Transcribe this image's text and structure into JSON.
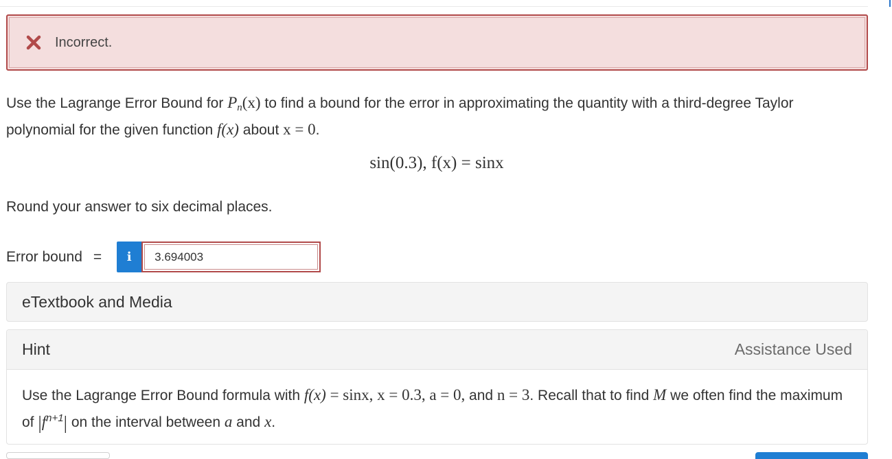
{
  "alert": {
    "text": "Incorrect.",
    "icon": "x-icon",
    "color": "#b14a4a"
  },
  "question": {
    "t1": "Use the Lagrange Error Bound for ",
    "P": "P",
    "n": "n",
    "px": "(x)",
    "t2": " to find a bound for the error in approximating the quantity with a third-degree Taylor polynomial for the given function ",
    "fx": "f(x)",
    "t3": " about ",
    "about": "x = 0",
    "t4": "."
  },
  "expression": "sin(0.3), f(x) = sinx",
  "instruction": "Round your answer to six decimal places.",
  "answer": {
    "label": "Error bound",
    "equals": "=",
    "info_icon": "i",
    "value": "3.694003"
  },
  "etextbook": {
    "label": "eTextbook and Media"
  },
  "hint": {
    "title": "Hint",
    "status": "Assistance Used",
    "b1": "Use the Lagrange Error Bound formula with ",
    "fx": "f(x)",
    "eq1": " = sinx, x = 0.3, a = 0, ",
    "and1": "and ",
    "n_eq": "n = ",
    "three": "3",
    "b2": ". Recall that to find ",
    "M": "M",
    "b3": " we often find the maximum of ",
    "bar_l": "|",
    "f": "f",
    "sup": "n+1",
    "bar_r": "|",
    "b4": " on the interval between ",
    "a": "a",
    "and2": " and ",
    "x": "x",
    "b5": "."
  },
  "colors": {
    "accent": "#1f7ed3",
    "error_border": "#b14a4a",
    "error_bg": "#f4dede"
  }
}
